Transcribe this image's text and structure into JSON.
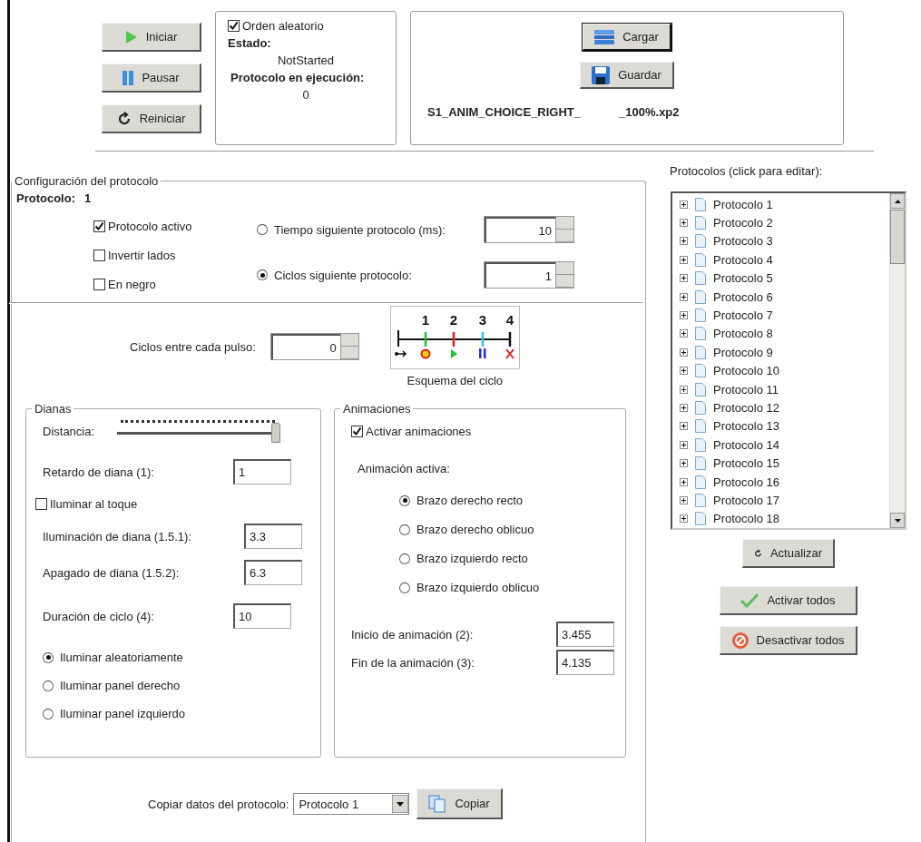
{
  "controls": [
    {
      "label": "Iniciar",
      "kind": "play"
    },
    {
      "label": "Pausar",
      "kind": "pause"
    },
    {
      "label": "Reiniciar",
      "kind": "restart"
    }
  ],
  "status": {
    "random_order": {
      "label": "Orden aleatorio",
      "checked": true
    },
    "state_label": "Estado:",
    "state_value": "NotStarted",
    "running_label": "Protocolo en ejecución:",
    "running_value": "0"
  },
  "file": {
    "buttons": [
      {
        "label": "Cargar",
        "kind": "load",
        "focused": true
      },
      {
        "label": "Guardar",
        "kind": "save",
        "focused": false
      }
    ],
    "name_start": "S1_ANIM_CHOICE_RIGHT_",
    "name_end": "_100%.xp2"
  },
  "config": {
    "title": "Configuración del protocolo",
    "protocol_label": "Protocolo:",
    "protocol_value": "1",
    "checkboxes": [
      {
        "label": "Protocolo activo",
        "checked": true
      },
      {
        "label": "Invertir lados",
        "checked": false
      },
      {
        "label": "En negro",
        "checked": false
      }
    ],
    "next_options": [
      {
        "label": "Tiempo siguiente protocolo (ms):",
        "selected": false,
        "value": "10"
      },
      {
        "label": "Ciclos siguiente protocolo:",
        "selected": true,
        "value": "1"
      }
    ],
    "pulse": {
      "label": "Ciclos entre cada pulso:",
      "value": "0"
    },
    "schema": {
      "caption": "Esquema del ciclo",
      "steps": [
        {
          "number": "1",
          "color": "#22c03a",
          "kind": "target"
        },
        {
          "number": "2",
          "color": "#e02020",
          "kind": "play"
        },
        {
          "number": "3",
          "color": "#20c8e8",
          "kind": "pause"
        },
        {
          "number": "4",
          "color": "#111111",
          "kind": "stop"
        }
      ]
    }
  },
  "dianas": {
    "title": "Dianas",
    "distance": {
      "label": "Distancia:",
      "level": 1
    },
    "rows": [
      {
        "kind": "field",
        "label": "Retardo de diana (1):",
        "value": "1"
      },
      {
        "kind": "checkbox",
        "label": "Iluminar al toque",
        "checked": false
      },
      {
        "kind": "field",
        "label": "Iluminación de diana (1.5.1):",
        "value": "3.3"
      },
      {
        "kind": "field",
        "label": "Apagado de diana (1.5.2):",
        "value": "6.3"
      },
      {
        "kind": "field",
        "label": "Duración de ciclo (4):",
        "value": "10"
      }
    ],
    "options": [
      {
        "label": "Iluminar aleatoriamente",
        "selected": true
      },
      {
        "label": "Iluminar panel derecho",
        "selected": false
      },
      {
        "label": "Iluminar panel izquierdo",
        "selected": false
      }
    ]
  },
  "animaciones": {
    "title": "Animaciones",
    "enable": {
      "label": "Activar animaciones",
      "checked": true
    },
    "active_label": "Animación activa:",
    "options": [
      {
        "label": "Brazo derecho recto",
        "selected": true
      },
      {
        "label": "Brazo derecho oblicuo",
        "selected": false
      },
      {
        "label": "Brazo izquierdo recto",
        "selected": false
      },
      {
        "label": "Brazo izquierdo oblicuo",
        "selected": false
      }
    ],
    "fields": [
      {
        "label": "Inicio de animación (2):",
        "value": "3.455"
      },
      {
        "label": "Fin de la animación (3):",
        "value": "4.135"
      }
    ]
  },
  "copy": {
    "label": "Copiar datos del protocolo:",
    "selected_value": "Protocolo 1",
    "button": "Copiar"
  },
  "protocols": {
    "title": "Protocolos (click para editar):",
    "items": [
      {
        "label": "Protocolo 1",
        "expanded": false
      },
      {
        "label": "Protocolo 2",
        "expanded": false
      },
      {
        "label": "Protocolo 3",
        "expanded": false
      },
      {
        "label": "Protocolo 4",
        "expanded": false
      },
      {
        "label": "Protocolo 5",
        "expanded": false
      },
      {
        "label": "Protocolo 6",
        "expanded": false
      },
      {
        "label": "Protocolo 7",
        "expanded": false
      },
      {
        "label": "Protocolo 8",
        "expanded": false
      },
      {
        "label": "Protocolo 9",
        "expanded": false
      },
      {
        "label": "Protocolo 10",
        "expanded": false
      },
      {
        "label": "Protocolo 11",
        "expanded": false
      },
      {
        "label": "Protocolo 12",
        "expanded": false
      },
      {
        "label": "Protocolo 13",
        "expanded": false
      },
      {
        "label": "Protocolo 14",
        "expanded": false
      },
      {
        "label": "Protocolo 15",
        "expanded": false
      },
      {
        "label": "Protocolo 16",
        "expanded": false
      },
      {
        "label": "Protocolo 17",
        "expanded": false
      },
      {
        "label": "Protocolo 18",
        "expanded": false
      }
    ]
  },
  "actions": [
    {
      "label": "Actualizar",
      "kind": "refresh"
    },
    {
      "label": "Activar todos",
      "kind": "check"
    },
    {
      "label": "Desactivar todos",
      "kind": "forbid"
    }
  ]
}
